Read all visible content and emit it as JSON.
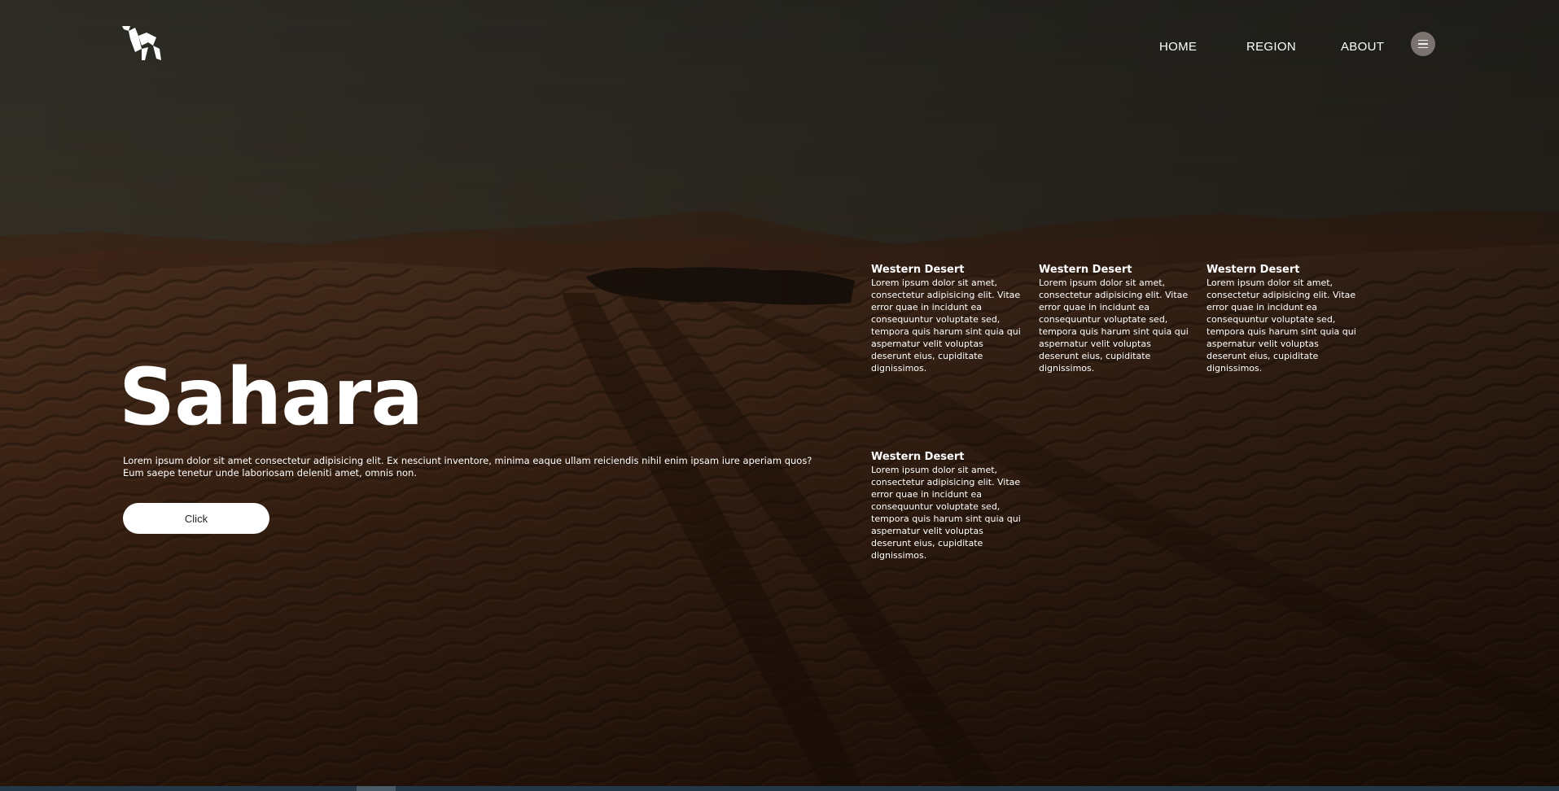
{
  "nav": {
    "items": [
      {
        "label": "HOME"
      },
      {
        "label": "REGION"
      },
      {
        "label": "ABOUT"
      }
    ],
    "menu_icon": "hamburger-icon"
  },
  "logo": {
    "icon": "camel-logo-icon"
  },
  "hero": {
    "title": "Sahara",
    "description": "Lorem ipsum dolor sit amet consectetur adipisicing elit. Ex nesciunt inventore, minima eaque ullam reiciendis nihil enim ipsam iure aperiam quos? Eum saepe tenetur unde laboriosam deleniti amet, omnis non.",
    "button_label": "Click"
  },
  "regions": [
    {
      "title": "Western Desert",
      "text": "Lorem ipsum dolor sit amet, consectetur adipisicing elit. Vitae error quae in incidunt ea consequuntur voluptate sed, tempora quis harum sint quia qui aspernatur velit voluptas deserunt eius, cupiditate dignissimos."
    },
    {
      "title": "Western Desert",
      "text": "Lorem ipsum dolor sit amet, consectetur adipisicing elit. Vitae error quae in incidunt ea consequuntur voluptate sed, tempora quis harum sint quia qui aspernatur velit voluptas deserunt eius, cupiditate dignissimos."
    },
    {
      "title": "Western Desert",
      "text": "Lorem ipsum dolor sit amet, consectetur adipisicing elit. Vitae error quae in incidunt ea consequuntur voluptate sed, tempora quis harum sint quia qui aspernatur velit voluptas deserunt eius, cupiditate dignissimos."
    },
    {
      "title": "Western Desert",
      "text": "Lorem ipsum dolor sit amet, consectetur adipisicing elit. Vitae error quae in incidunt ea consequuntur voluptate sed, tempora quis harum sint quia qui aspernatur velit voluptas deserunt eius, cupiditate dignissimos."
    }
  ],
  "colors": {
    "sky_top": "#2f2c24",
    "sky_horizon": "#4a3d2c",
    "sand": "#4a2a18",
    "sand_dark": "#2e190d",
    "button_bg": "#ffffff",
    "menu_button_bg": "#7a7370"
  }
}
